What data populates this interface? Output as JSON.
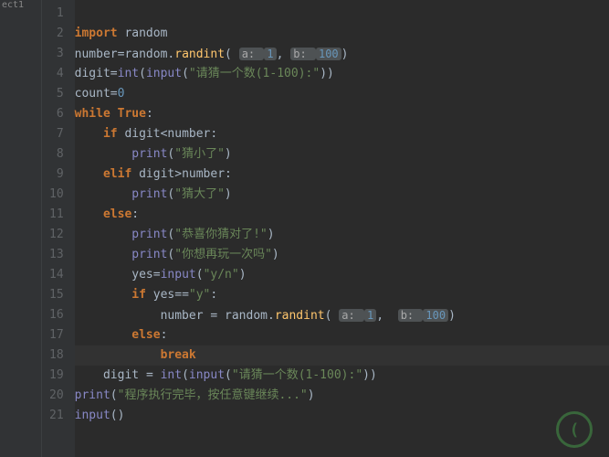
{
  "sidebar": {
    "label": "ect1"
  },
  "lines": [
    {
      "n": 1,
      "indent": 0,
      "tokens": []
    },
    {
      "n": 2,
      "indent": 0,
      "tokens": [
        [
          "kw",
          "import"
        ],
        [
          "sp",
          " "
        ],
        [
          "id",
          "random"
        ]
      ]
    },
    {
      "n": 3,
      "indent": 0,
      "tokens": [
        [
          "id",
          "number"
        ],
        [
          "op",
          "="
        ],
        [
          "id",
          "random"
        ],
        [
          "op",
          "."
        ],
        [
          "fn",
          "randint"
        ],
        [
          "op",
          "("
        ],
        [
          "sp",
          " "
        ],
        [
          "hint",
          "a: "
        ],
        [
          "hintn",
          "1"
        ],
        [
          "op",
          ","
        ],
        [
          "sp",
          " "
        ],
        [
          "hint",
          "b: "
        ],
        [
          "hintn",
          "100"
        ],
        [
          "op",
          ")"
        ]
      ]
    },
    {
      "n": 4,
      "indent": 0,
      "tokens": [
        [
          "id",
          "digit"
        ],
        [
          "op",
          "="
        ],
        [
          "builtin",
          "int"
        ],
        [
          "op",
          "("
        ],
        [
          "builtin",
          "input"
        ],
        [
          "op",
          "("
        ],
        [
          "str",
          "\"请猜一个数(1-100):\""
        ],
        [
          "op",
          "))"
        ]
      ]
    },
    {
      "n": 5,
      "indent": 0,
      "tokens": [
        [
          "id",
          "count"
        ],
        [
          "op",
          "="
        ],
        [
          "num",
          "0"
        ]
      ]
    },
    {
      "n": 6,
      "indent": 0,
      "tokens": [
        [
          "kw",
          "while"
        ],
        [
          "sp",
          " "
        ],
        [
          "kw",
          "True"
        ],
        [
          "op",
          ":"
        ]
      ]
    },
    {
      "n": 7,
      "indent": 1,
      "tokens": [
        [
          "kw",
          "if"
        ],
        [
          "sp",
          " "
        ],
        [
          "id",
          "digit"
        ],
        [
          "op",
          "<"
        ],
        [
          "id",
          "number"
        ],
        [
          "op",
          ":"
        ]
      ]
    },
    {
      "n": 8,
      "indent": 2,
      "tokens": [
        [
          "builtin",
          "print"
        ],
        [
          "op",
          "("
        ],
        [
          "str",
          "\"猜小了\""
        ],
        [
          "op",
          ")"
        ]
      ]
    },
    {
      "n": 9,
      "indent": 1,
      "tokens": [
        [
          "kw",
          "elif"
        ],
        [
          "sp",
          " "
        ],
        [
          "id",
          "digit"
        ],
        [
          "op",
          ">"
        ],
        [
          "id",
          "number"
        ],
        [
          "op",
          ":"
        ]
      ]
    },
    {
      "n": 10,
      "indent": 2,
      "tokens": [
        [
          "builtin",
          "print"
        ],
        [
          "op",
          "("
        ],
        [
          "str",
          "\"猜大了\""
        ],
        [
          "op",
          ")"
        ]
      ]
    },
    {
      "n": 11,
      "indent": 1,
      "tokens": [
        [
          "kw",
          "else"
        ],
        [
          "op",
          ":"
        ]
      ]
    },
    {
      "n": 12,
      "indent": 2,
      "tokens": [
        [
          "builtin",
          "print"
        ],
        [
          "op",
          "("
        ],
        [
          "str",
          "\"恭喜你猜对了!\""
        ],
        [
          "op",
          ")"
        ]
      ]
    },
    {
      "n": 13,
      "indent": 2,
      "tokens": [
        [
          "builtin",
          "print"
        ],
        [
          "op",
          "("
        ],
        [
          "str",
          "\"你想再玩一次吗\""
        ],
        [
          "op",
          ")"
        ]
      ]
    },
    {
      "n": 14,
      "indent": 2,
      "tokens": [
        [
          "id",
          "yes"
        ],
        [
          "op",
          "="
        ],
        [
          "builtin",
          "input"
        ],
        [
          "op",
          "("
        ],
        [
          "str",
          "\"y/n\""
        ],
        [
          "op",
          ")"
        ]
      ]
    },
    {
      "n": 15,
      "indent": 2,
      "tokens": [
        [
          "kw",
          "if"
        ],
        [
          "sp",
          " "
        ],
        [
          "id",
          "yes"
        ],
        [
          "op",
          "=="
        ],
        [
          "str",
          "\"y\""
        ],
        [
          "op",
          ":"
        ]
      ]
    },
    {
      "n": 16,
      "indent": 3,
      "tokens": [
        [
          "id",
          "number"
        ],
        [
          "sp",
          " "
        ],
        [
          "op",
          "="
        ],
        [
          "sp",
          " "
        ],
        [
          "id",
          "random"
        ],
        [
          "op",
          "."
        ],
        [
          "fn",
          "randint"
        ],
        [
          "op",
          "("
        ],
        [
          "sp",
          " "
        ],
        [
          "hint",
          "a: "
        ],
        [
          "hintn",
          "1"
        ],
        [
          "op",
          ","
        ],
        [
          "sp",
          "  "
        ],
        [
          "hint",
          "b: "
        ],
        [
          "hintn",
          "100"
        ],
        [
          "op",
          ")"
        ]
      ]
    },
    {
      "n": 17,
      "indent": 2,
      "tokens": [
        [
          "kw",
          "else"
        ],
        [
          "op",
          ":"
        ]
      ]
    },
    {
      "n": 18,
      "indent": 3,
      "hl": true,
      "tokens": [
        [
          "kw",
          "break"
        ]
      ]
    },
    {
      "n": 19,
      "indent": 1,
      "tokens": [
        [
          "id",
          "digit"
        ],
        [
          "sp",
          " "
        ],
        [
          "op",
          "="
        ],
        [
          "sp",
          " "
        ],
        [
          "builtin",
          "int"
        ],
        [
          "op",
          "("
        ],
        [
          "builtin",
          "input"
        ],
        [
          "op",
          "("
        ],
        [
          "str",
          "\"请猜一个数(1-100):\""
        ],
        [
          "op",
          "))"
        ]
      ]
    },
    {
      "n": 20,
      "indent": 0,
      "tokens": [
        [
          "builtin",
          "print"
        ],
        [
          "op",
          "("
        ],
        [
          "str",
          "\"程序执行完毕，按任意键继续...\""
        ],
        [
          "op",
          ")"
        ]
      ]
    },
    {
      "n": 21,
      "indent": 0,
      "tokens": [
        [
          "builtin",
          "input"
        ],
        [
          "op",
          "()"
        ]
      ]
    }
  ],
  "indent_unit": "    ",
  "watermark": {
    "glyph": "("
  }
}
